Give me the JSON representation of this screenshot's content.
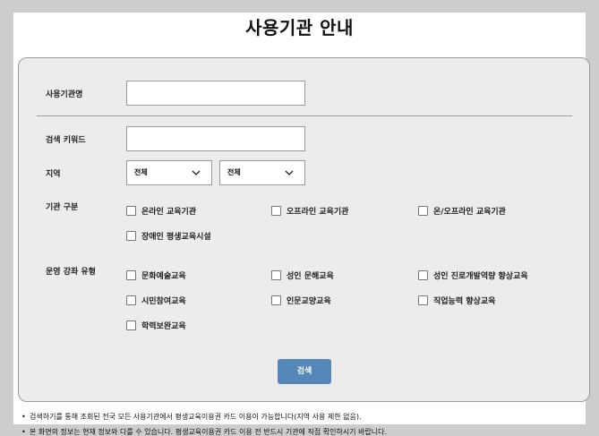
{
  "page": {
    "title": "사용기관 안내"
  },
  "form": {
    "institution_name_label": "사용기관명",
    "institution_name_value": "",
    "keyword_label": "검색 키워드",
    "keyword_value": "",
    "region_label": "지역",
    "region_select_1": "전체",
    "region_select_2": "전체",
    "category_label": "기관 구분",
    "categories": [
      {
        "label": "온라인 교육기관",
        "checked": false
      },
      {
        "label": "오프라인 교육기관",
        "checked": false
      },
      {
        "label": "온/오프라인 교육기관",
        "checked": false
      },
      {
        "label": "장애인 평생교육시설",
        "checked": false
      }
    ],
    "course_type_label": "운영 강좌 유형",
    "course_types": [
      {
        "label": "문화예술교육",
        "checked": false
      },
      {
        "label": "성인 문해교육",
        "checked": false
      },
      {
        "label": "성인 진로개발역량 향상교육",
        "checked": false
      },
      {
        "label": "시민참여교육",
        "checked": false
      },
      {
        "label": "인문교양교육",
        "checked": false
      },
      {
        "label": "직업능력 향상교육",
        "checked": false
      },
      {
        "label": "학력보완교육",
        "checked": false
      }
    ],
    "search_button": "검색"
  },
  "notes": [
    "검색하기를 통해 조회된 전국 모든 사용기관에서 평생교육이용권 카드 이용이 가능합니다(지역 사용 제한 없음).",
    "본 화면의 정보는 현재 정보와 다를 수 있습니다. 평생교육이용권 카드 이용 전 반드시 기관에 직접 확인하시기 바랍니다."
  ],
  "icons": {
    "select_arrow": "chevron-down-icon",
    "note_bullet": "bullet-icon"
  }
}
